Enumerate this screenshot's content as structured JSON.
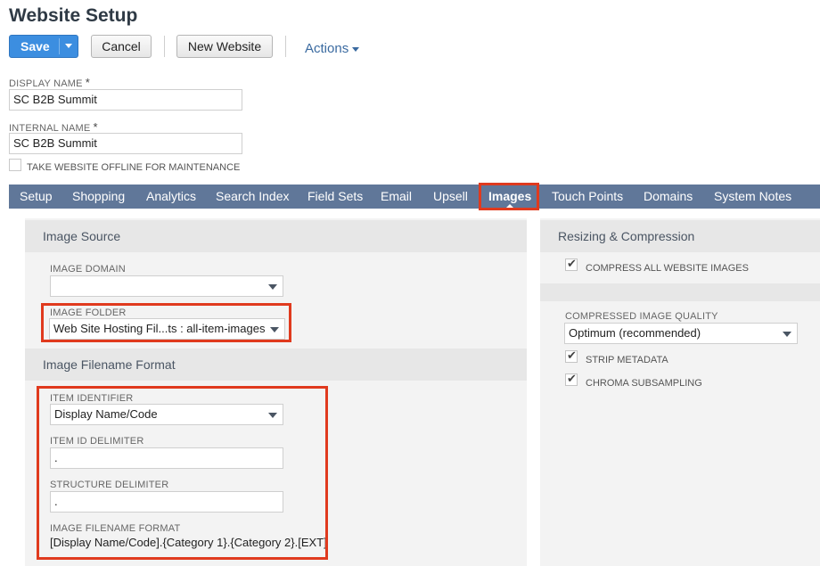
{
  "page": {
    "title": "Website Setup"
  },
  "toolbar": {
    "save_label": "Save",
    "cancel_label": "Cancel",
    "new_website_label": "New Website",
    "actions_label": "Actions"
  },
  "form": {
    "display_name": {
      "label": "DISPLAY NAME",
      "required_mark": "*",
      "value": "SC B2B Summit"
    },
    "internal_name": {
      "label": "INTERNAL NAME",
      "required_mark": "*",
      "value": "SC B2B Summit"
    },
    "offline_checkbox": {
      "label": "TAKE WEBSITE OFFLINE FOR MAINTENANCE",
      "checked": false
    }
  },
  "tabs": [
    {
      "label": "Setup"
    },
    {
      "label": "Shopping"
    },
    {
      "label": "Analytics"
    },
    {
      "label": "Search Index"
    },
    {
      "label": "Field Sets"
    },
    {
      "label": "Email"
    },
    {
      "label": "Upsell"
    },
    {
      "label": "Images",
      "active": true
    },
    {
      "label": "Touch Points"
    },
    {
      "label": "Domains"
    },
    {
      "label": "System Notes"
    }
  ],
  "image_source": {
    "header": "Image Source",
    "image_domain": {
      "label": "IMAGE DOMAIN",
      "value": ""
    },
    "image_folder": {
      "label": "IMAGE FOLDER",
      "value": "Web Site Hosting Fil...ts : all-item-images"
    }
  },
  "image_filename_format": {
    "header": "Image Filename Format",
    "item_identifier": {
      "label": "ITEM IDENTIFIER",
      "value": "Display Name/Code"
    },
    "item_id_delimiter": {
      "label": "ITEM ID DELIMITER",
      "value": "."
    },
    "structure_delimiter": {
      "label": "STRUCTURE DELIMITER",
      "value": "."
    },
    "image_filename_format": {
      "label": "IMAGE FILENAME FORMAT",
      "value": "[Display Name/Code].{Category 1}.{Category 2}.[EXT]"
    }
  },
  "resizing": {
    "header": "Resizing & Compression",
    "compress_all": {
      "label": "COMPRESS ALL WEBSITE IMAGES",
      "checked": true
    },
    "quality": {
      "label": "COMPRESSED IMAGE QUALITY",
      "value": "Optimum (recommended)"
    },
    "strip_metadata": {
      "label": "STRIP METADATA",
      "checked": true
    },
    "chroma_subsampling": {
      "label": "CHROMA SUBSAMPLING",
      "checked": true
    }
  },
  "colors": {
    "tabbar": "#607799",
    "save_button": "#3c8ee0",
    "highlight": "#e03a1e"
  }
}
